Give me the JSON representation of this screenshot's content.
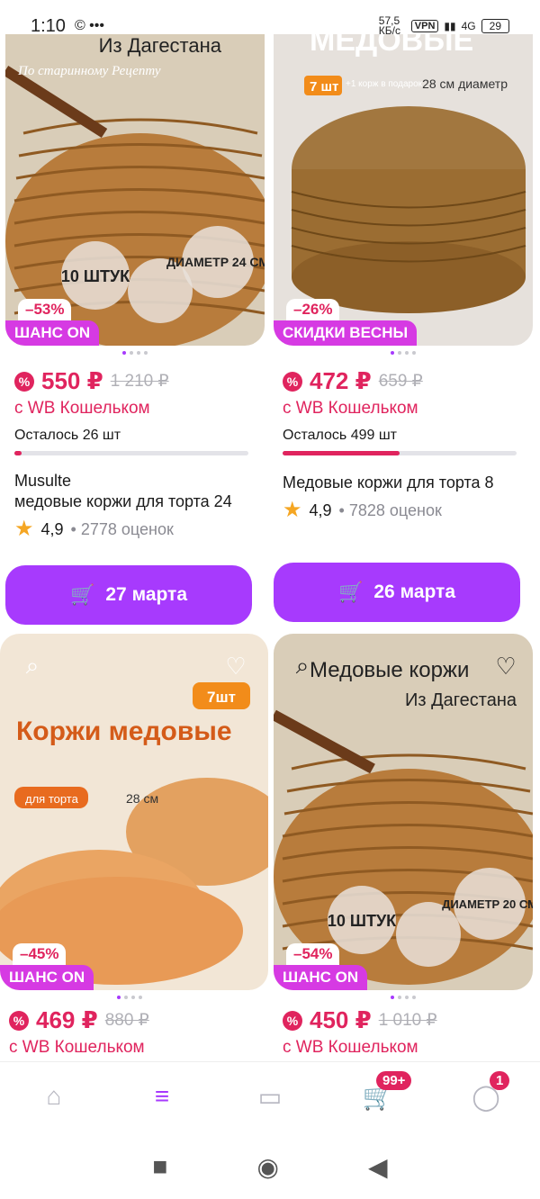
{
  "status": {
    "time": "1:10",
    "icons": "© •••",
    "speed": "57,5 КБ/с",
    "vpn": "VPN",
    "network": "4G",
    "battery": "29"
  },
  "products": [
    {
      "discount": "–53%",
      "promo": "ШАНС ON",
      "price": "550 ₽",
      "old_price": "1 210 ₽",
      "wallet": "с WB Кошельком",
      "stock": "Осталось 26 шт",
      "stock_fill": 0.03,
      "brand": "Musulte",
      "name": "медовые коржи для торта 24",
      "rating": "4,9",
      "reviews": "2778 оценок",
      "delivery": "27 марта",
      "photo_text": "Из Дагестана",
      "photo_sub": "По старинному Рецепту",
      "photo_count": "10 ШТУК",
      "photo_diam": "ДИАМЕТР 24 СМ"
    },
    {
      "discount": "–26%",
      "promo": "СКИДКИ ВЕСНЫ",
      "price": "472 ₽",
      "old_price": "659 ₽",
      "wallet": "с WB Кошельком",
      "stock": "Осталось 499 шт",
      "stock_fill": 0.5,
      "brand": "",
      "name": "Медовые коржи для торта 8",
      "rating": "4,9",
      "reviews": "7828 оценок",
      "delivery": "26 марта",
      "photo_text": "МЕДОВЫЕ",
      "photo_sub": "28 см диаметр",
      "photo_count": "7 шт",
      "photo_diam": "+1 корж в подарок"
    },
    {
      "discount": "–45%",
      "promo": "ШАНС ON",
      "price": "469 ₽",
      "old_price": "880 ₽",
      "wallet": "с WB Кошельком",
      "photo_text": "Коржи медовые",
      "photo_sub": "для торта",
      "photo_count": "7шт",
      "photo_diam": "28 см"
    },
    {
      "discount": "–54%",
      "promo": "ШАНС ON",
      "price": "450 ₽",
      "old_price": "1 010 ₽",
      "wallet": "с WB Кошельком",
      "photo_text": "Медовые коржи",
      "photo_sub": "Из Дагестана",
      "photo_count": "10 ШТУК",
      "photo_diam": "ДИАМЕТР 20 СМ"
    }
  ],
  "tabbar": {
    "cart_count": "99+",
    "profile_count": "1"
  },
  "colors": {
    "accent": "#a73afd",
    "price": "#e0245e",
    "promo": "#d63ae3"
  },
  "icons": [
    "home-icon",
    "catalog-search-icon",
    "wallet-icon",
    "cart-icon",
    "profile-icon",
    "heart-icon",
    "image-search-icon"
  ]
}
